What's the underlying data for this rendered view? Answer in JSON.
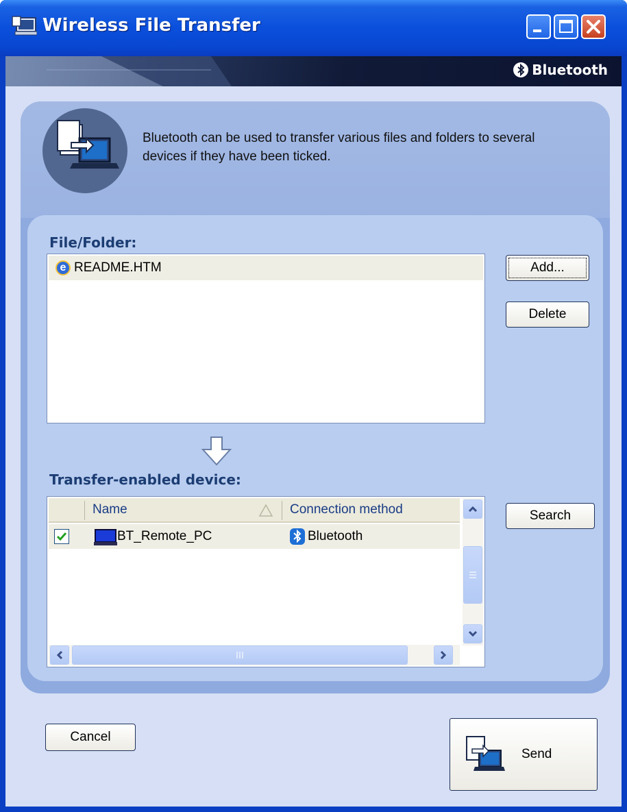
{
  "window": {
    "title": "Wireless File Transfer",
    "brand": "Bluetooth",
    "colors": {
      "titlebar": "#0a4fdc",
      "panel": "#8eaadf",
      "inner_panel": "#b9cdf0",
      "label": "#1c3d73",
      "link": "#1a3c86"
    }
  },
  "description": {
    "text": "Bluetooth can be used to transfer various files and folders to several devices if they have been ticked.",
    "icon": "file-transfer-icon"
  },
  "files": {
    "label": "File/Folder:",
    "items": [
      {
        "name": "README.HTM",
        "icon": "internet-explorer-icon"
      }
    ],
    "add_button": "Add...",
    "delete_button": "Delete"
  },
  "devices": {
    "label": "Transfer-enabled device:",
    "columns": {
      "name": "Name",
      "connection": "Connection method"
    },
    "rows": [
      {
        "checked": true,
        "name": "BT_Remote_PC",
        "icon": "computer-icon",
        "connection": "Bluetooth",
        "connection_icon": "bluetooth-icon"
      }
    ],
    "search_button": "Search"
  },
  "footer": {
    "cancel_button": "Cancel",
    "send_button": "Send"
  }
}
